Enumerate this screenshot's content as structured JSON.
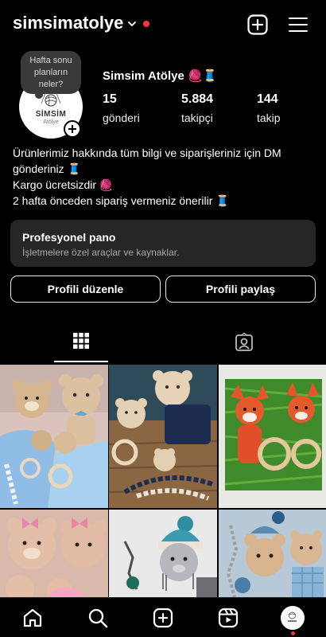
{
  "header": {
    "username": "simsimatolye"
  },
  "note": {
    "text_1": "Hafta sonu",
    "text_2": "planların",
    "text_3": "neler?"
  },
  "avatar": {
    "brand": "SİMSİM",
    "sub": "Atölye"
  },
  "profile": {
    "display_name": "Simsim Atölye 🧶🧵",
    "stats": [
      {
        "value": "15",
        "label": "gönderi"
      },
      {
        "value": "5.884",
        "label": "takipçi"
      },
      {
        "value": "144",
        "label": "takip"
      }
    ],
    "bio": [
      "Ürünlerimiz hakkında tüm bilgi ve siparişleriniz için DM",
      "gönderiniz 🧵",
      "Kargo ücretsizdir 🧶",
      "2 hafta önceden sipariş vermeniz önerilir 🧵"
    ]
  },
  "pro_dashboard": {
    "title": "Profesyonel pano",
    "subtitle": "İşletmelere özel araçlar ve kaynaklar."
  },
  "buttons": {
    "edit": "Profili düzenle",
    "share": "Profili paylaş"
  },
  "tabs": {
    "active": "grid-icon",
    "icons": [
      "grid-icon",
      "tagged-icon"
    ]
  },
  "nav": {
    "icons": [
      "home-icon",
      "search-icon",
      "create-icon",
      "reels-icon",
      "profile-avatar"
    ]
  },
  "colors": {
    "background": "#000000",
    "card": "#262626",
    "notification": "#ff3040"
  },
  "posts": [
    {
      "description": "Crochet teddy bears and bunny on pink blanket with blue lovey"
    },
    {
      "description": "Crochet bear toys with rattle and pacifier clip on wood"
    },
    {
      "description": "Orange crochet fox toys in gift box with green filler"
    },
    {
      "description": "Pink crochet bears with bows"
    },
    {
      "description": "Crochet teddy with teal hat"
    },
    {
      "description": "Crochet bears with blue blanket and pacifier clip"
    }
  ]
}
